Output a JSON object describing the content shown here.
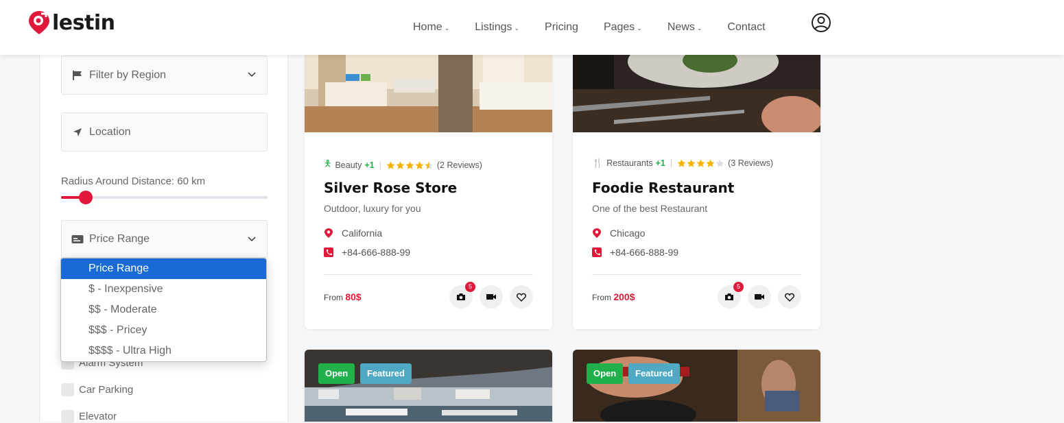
{
  "brand": {
    "name": "lestin",
    "accent": "#e0193b"
  },
  "nav": {
    "items": [
      {
        "label": "Home",
        "has_caret": true
      },
      {
        "label": "Listings",
        "has_caret": true
      },
      {
        "label": "Pricing",
        "has_caret": false
      },
      {
        "label": "Pages",
        "has_caret": true
      },
      {
        "label": "News",
        "has_caret": true
      },
      {
        "label": "Contact",
        "has_caret": false
      }
    ],
    "caret": "⌄",
    "user_icon": "user-circle-icon"
  },
  "filters": {
    "region": {
      "label": "Filter by Region",
      "icon": "flag-icon"
    },
    "location": {
      "placeholder": "Location",
      "icon": "navigation-arrow-icon"
    },
    "radius": {
      "label": "Radius Around Distance: 60 km",
      "value_km": 60,
      "fraction": 0.12
    },
    "price_range": {
      "label": "Price Range",
      "icon": "card-icon",
      "options": [
        "Price Range",
        "$ - Inexpensive",
        "$$ - Moderate",
        "$$$ - Pricey",
        "$$$$ - Ultra High"
      ],
      "selected_index": 0
    },
    "amenities": [
      "Alarm System",
      "Car Parking",
      "Elevator"
    ]
  },
  "listings": [
    {
      "category": "Beauty",
      "category_extra": "+1",
      "rating": 4.5,
      "reviews": "(2 Reviews)",
      "title": "Silver Rose Store",
      "subtitle": "Outdoor, luxury for you",
      "location": "California",
      "phone": "+84-666-888-99",
      "price_prefix": "From",
      "price": "80$",
      "photo_count": "5"
    },
    {
      "category": "Restaurants",
      "category_extra": "+1",
      "rating": 4,
      "reviews": "(3 Reviews)",
      "title": "Foodie Restaurant",
      "subtitle": "One of the best Restaurant",
      "location": "Chicago",
      "phone": "+84-666-888-99",
      "price_prefix": "From",
      "price": "200$",
      "photo_count": "5"
    },
    {
      "tags": [
        "Open",
        "Featured"
      ]
    },
    {
      "tags": [
        "Open",
        "Featured"
      ]
    }
  ]
}
